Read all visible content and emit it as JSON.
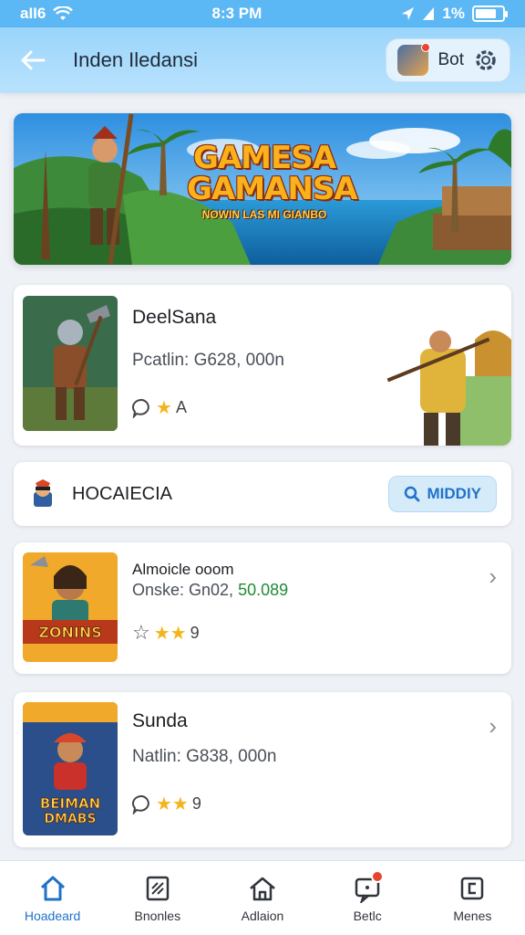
{
  "status_bar": {
    "left": "aII6",
    "time": "8:3 PM",
    "right": "1%"
  },
  "header": {
    "title": "Inden Iledansi",
    "profile_name": "Bot"
  },
  "banner": {
    "title": "GAMESA GAMANSA",
    "subtitle": "NOWIN LAS MI GIANBO"
  },
  "featured": {
    "title": "DeelSana",
    "subtitle": "Pcatlin: G628, 000n",
    "rating_text": "A"
  },
  "section": {
    "title": "HOCAIECIA",
    "button_label": "MIDDIY"
  },
  "list": [
    {
      "title": "Almoicle ooom",
      "subtitle_prefix": "Onske: Gn02,",
      "subtitle_value": "50.089",
      "rating_text": "9"
    },
    {
      "title": "Sunda",
      "subtitle_prefix": "Natlin: G838, 000n",
      "subtitle_value": "",
      "rating_text": "9"
    }
  ],
  "nav": [
    {
      "label": "Hoadeard",
      "icon": "home-icon"
    },
    {
      "label": "Bnonles",
      "icon": "notes-icon"
    },
    {
      "label": "Adlaion",
      "icon": "house-icon"
    },
    {
      "label": "Betlc",
      "icon": "chat-icon"
    },
    {
      "label": "Menes",
      "icon": "menu-icon"
    }
  ],
  "colors": {
    "accent": "#1f72c9",
    "header_bg": "#9ad5fb",
    "star": "#f3b51a",
    "price_green": "#1f8b34"
  }
}
